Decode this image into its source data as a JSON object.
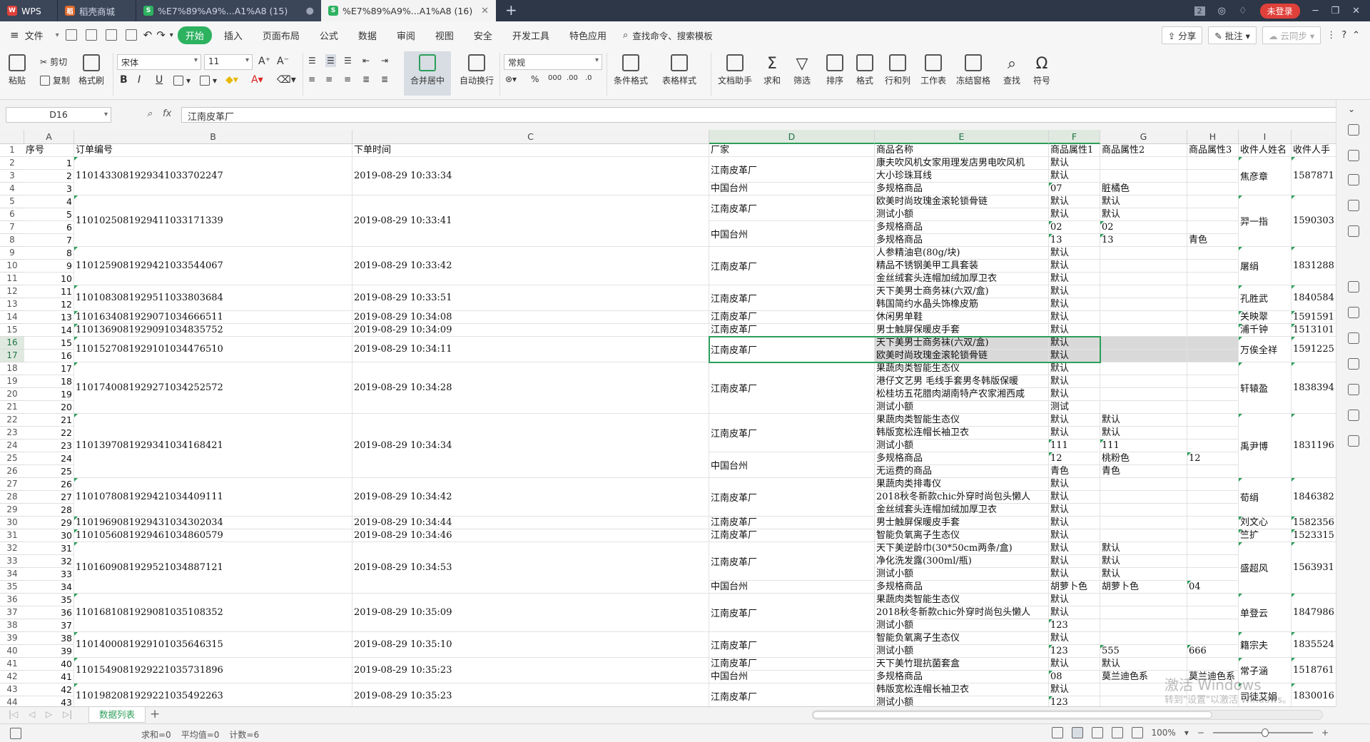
{
  "titlebar": {
    "tabs": [
      {
        "label": "WPS"
      },
      {
        "label": "稻壳商城"
      },
      {
        "label": "%E7%89%A9%...A1%A8 (15)"
      },
      {
        "label": "%E7%89%A9%...A1%A8 (16)"
      }
    ],
    "login": "未登录",
    "badge": "2"
  },
  "menubar": {
    "file": "文件",
    "items": [
      "开始",
      "插入",
      "页面布局",
      "公式",
      "数据",
      "审阅",
      "视图",
      "安全",
      "开发工具",
      "特色应用"
    ],
    "search": "查找命令、搜索模板",
    "share": "分享",
    "comment": "批注",
    "sync": "云同步"
  },
  "ribbon": {
    "paste": "粘贴",
    "cut": "剪切",
    "copy": "复制",
    "format_painter": "格式刷",
    "font": "宋体",
    "size": "11",
    "merge": "合并居中",
    "wrap": "自动换行",
    "numfmt": "常规",
    "cond_fmt": "条件格式",
    "table_style": "表格样式",
    "doc_helper": "文档助手",
    "sum": "求和",
    "filter": "筛选",
    "sort": "排序",
    "format": "格式",
    "rowcol": "行和列",
    "sheet": "工作表",
    "freeze": "冻结窗格",
    "find": "查找",
    "symbol": "符号"
  },
  "formulabar": {
    "namebox": "D16",
    "fx": "fx",
    "formula": "江南皮革厂"
  },
  "columns": [
    {
      "letter": "A"
    },
    {
      "letter": "B"
    },
    {
      "letter": "C"
    },
    {
      "letter": "D"
    },
    {
      "letter": "E"
    },
    {
      "letter": "F"
    },
    {
      "letter": "G"
    },
    {
      "letter": "H"
    },
    {
      "letter": "I"
    },
    {
      "letter": ""
    }
  ],
  "headers": [
    "序号",
    "订单编号",
    "下单时间",
    "厂家",
    "商品名称",
    "商品属性1",
    "商品属性2",
    "商品属性3",
    "收件人姓名",
    "收件人手"
  ],
  "rownums": [
    "1",
    "2",
    "3",
    "4",
    "5",
    "6",
    "7",
    "8",
    "9",
    "10",
    "11",
    "12",
    "13",
    "14",
    "15",
    "16",
    "17",
    "18",
    "19",
    "20",
    "21",
    "22",
    "23",
    "24",
    "25",
    "26",
    "27",
    "28",
    "29",
    "30",
    "31",
    "32",
    "33",
    "34",
    "35",
    "36",
    "37",
    "38",
    "39",
    "40",
    "41",
    "42",
    "43",
    "44"
  ],
  "seq": [
    "1",
    "2",
    "3",
    "4",
    "5",
    "6",
    "7",
    "8",
    "9",
    "10",
    "11",
    "12",
    "13",
    "14",
    "15",
    "16",
    "17",
    "18",
    "19",
    "20",
    "21",
    "22",
    "23",
    "24",
    "25",
    "26",
    "27",
    "28",
    "29",
    "30",
    "31",
    "32",
    "33",
    "34",
    "35",
    "36",
    "37",
    "38",
    "39",
    "40",
    "41",
    "42",
    "43"
  ],
  "orders": [
    {
      "rows": [
        2,
        3,
        4
      ],
      "id": "110143308192934103370​2247",
      "time": "2019-08-29 10:33:34",
      "recv": "焦彦章",
      "phone": "1587871"
    },
    {
      "rows": [
        5,
        6,
        7,
        8
      ],
      "id": "110102508192941103317​1339",
      "time": "2019-08-29 10:33:41",
      "recv": "羿一指",
      "phone": "1590303"
    },
    {
      "rows": [
        9,
        10,
        11
      ],
      "id": "110125908192942103354​4067",
      "time": "2019-08-29 10:33:42",
      "recv": "屠绢",
      "phone": "1831288"
    },
    {
      "rows": [
        12,
        13
      ],
      "id": "110108308192951103380​3684",
      "time": "2019-08-29 10:33:51",
      "recv": "孔胜武",
      "phone": "1840584"
    },
    {
      "rows": [
        14
      ],
      "id": "1101634081929071034666511",
      "time": "2019-08-29 10:34:08",
      "recv": "关映翠",
      "phone": "1591591"
    },
    {
      "rows": [
        15
      ],
      "id": "1101369081929091034835752",
      "time": "2019-08-29 10:34:09",
      "recv": "浦千钟",
      "phone": "1513101"
    },
    {
      "rows": [
        16,
        17
      ],
      "id": "1101527081929101034476510",
      "time": "2019-08-29 10:34:11",
      "recv": "万俟全祥",
      "phone": "1591225"
    },
    {
      "rows": [
        18,
        19,
        20,
        21
      ],
      "id": "1101740081929271034252572",
      "time": "2019-08-29 10:34:28",
      "recv": "轩辕盈",
      "phone": "1838394"
    },
    {
      "rows": [
        22,
        23,
        24,
        25,
        26
      ],
      "id": "1101397081929341034168421",
      "time": "2019-08-29 10:34:34",
      "recv": "禹尹博",
      "phone": "1831196"
    },
    {
      "rows": [
        27,
        28,
        29
      ],
      "id": "1101078081929421034409111",
      "time": "2019-08-29 10:34:42",
      "recv": "荀绢",
      "phone": "1846382"
    },
    {
      "rows": [
        30
      ],
      "id": "1101969081929431034302034",
      "time": "2019-08-29 10:34:44",
      "recv": "刘文心",
      "phone": "1582356"
    },
    {
      "rows": [
        31
      ],
      "id": "1101056081929461034860579",
      "time": "2019-08-29 10:34:46",
      "recv": "竺扩",
      "phone": "1523315"
    },
    {
      "rows": [
        32,
        33,
        34,
        35
      ],
      "id": "1101609081929521034887121",
      "time": "2019-08-29 10:34:53",
      "recv": "盛超风",
      "phone": "1563931"
    },
    {
      "rows": [
        36,
        37,
        38
      ],
      "id": "1101681081929081035108352",
      "time": "2019-08-29 10:35:09",
      "recv": "单登云",
      "phone": "1847986"
    },
    {
      "rows": [
        39,
        40
      ],
      "id": "1101400081929101035646315",
      "time": "2019-08-29 10:35:10",
      "recv": "籍宗夫",
      "phone": "1835524"
    },
    {
      "rows": [
        41,
        42
      ],
      "id": "1101549081929221035731896",
      "time": "2019-08-29 10:35:23",
      "recv": "常子涵",
      "phone": "1518761"
    },
    {
      "rows": [
        43,
        44
      ],
      "id": "1101982081929221035492263",
      "time": "2019-08-29 10:35:23",
      "recv": "司徒艾娟",
      "phone": "1830016"
    }
  ],
  "factories": [
    {
      "rows": [
        2,
        3
      ],
      "name": "江南皮革厂"
    },
    {
      "rows": [
        4
      ],
      "name": "中国台州"
    },
    {
      "rows": [
        5,
        6
      ],
      "name": "江南皮革厂"
    },
    {
      "rows": [
        7,
        8
      ],
      "name": "中国台州"
    },
    {
      "rows": [
        9,
        10,
        11
      ],
      "name": "江南皮革厂"
    },
    {
      "rows": [
        12,
        13
      ],
      "name": "江南皮革厂"
    },
    {
      "rows": [
        14
      ],
      "name": "江南皮革厂"
    },
    {
      "rows": [
        15
      ],
      "name": "江南皮革厂"
    },
    {
      "rows": [
        16,
        17
      ],
      "name": "江南皮革厂"
    },
    {
      "rows": [
        18,
        19,
        20,
        21
      ],
      "name": "江南皮革厂"
    },
    {
      "rows": [
        22,
        23,
        24
      ],
      "name": "江南皮革厂"
    },
    {
      "rows": [
        25,
        26
      ],
      "name": "中国台州"
    },
    {
      "rows": [
        27,
        28,
        29
      ],
      "name": "江南皮革厂"
    },
    {
      "rows": [
        30
      ],
      "name": "江南皮革厂"
    },
    {
      "rows": [
        31
      ],
      "name": "江南皮革厂"
    },
    {
      "rows": [
        32,
        33,
        34
      ],
      "name": "江南皮革厂"
    },
    {
      "rows": [
        35
      ],
      "name": "中国台州"
    },
    {
      "rows": [
        36,
        37,
        38
      ],
      "name": "江南皮革厂"
    },
    {
      "rows": [
        39,
        40
      ],
      "name": "江南皮革厂"
    },
    {
      "rows": [
        41
      ],
      "name": "江南皮革厂"
    },
    {
      "rows": [
        42
      ],
      "name": "中国台州"
    },
    {
      "rows": [
        43,
        44
      ],
      "name": "江南皮革厂"
    }
  ],
  "items": [
    [
      "康夫吹风机女家用理发店男电吹风机",
      "默认",
      "",
      ""
    ],
    [
      "大小珍珠耳线",
      "默认",
      "",
      ""
    ],
    [
      "多规格商品",
      "07",
      "脏橘色",
      ""
    ],
    [
      "欧美时尚玫瑰金滚轮锁骨链",
      "默认",
      "默认",
      ""
    ],
    [
      "测试小额",
      "默认",
      "默认",
      ""
    ],
    [
      "多规格商品",
      "02",
      "02",
      ""
    ],
    [
      "多规格商品",
      "13",
      "13",
      "青色"
    ],
    [
      "人参精油皂(80g/块)",
      "默认",
      "",
      ""
    ],
    [
      "精品不锈钢美甲工具套装",
      "默认",
      "",
      ""
    ],
    [
      "金丝绒套头连帽加绒加厚卫衣",
      "默认",
      "",
      ""
    ],
    [
      "天下美男士商务袜(六双/盒)",
      "默认",
      "",
      ""
    ],
    [
      "韩国简约水晶头饰橡皮筋",
      "默认",
      "",
      ""
    ],
    [
      "休闲男单鞋",
      "默认",
      "",
      ""
    ],
    [
      "男士触屏保暖皮手套",
      "默认",
      "",
      ""
    ],
    [
      "天下美男士商务袜(六双/盒)",
      "默认",
      "",
      ""
    ],
    [
      "欧美时尚玫瑰金滚轮锁骨链",
      "默认",
      "",
      ""
    ],
    [
      "果蔬肉类智能生态仪",
      "默认",
      "",
      ""
    ],
    [
      "港仔文艺男 毛线手套男冬韩版保暖",
      "默认",
      "",
      ""
    ],
    [
      "松桂坊五花腊肉湖南特产农家湘西咸",
      "默认",
      "",
      ""
    ],
    [
      "测试小额",
      "测试",
      "",
      ""
    ],
    [
      "果蔬肉类智能生态仪",
      "默认",
      "默认",
      ""
    ],
    [
      "韩版宽松连帽长袖卫衣",
      "默认",
      "默认",
      ""
    ],
    [
      "测试小额",
      "111",
      "111",
      ""
    ],
    [
      "多规格商品",
      "12",
      "桃粉色",
      "12"
    ],
    [
      "无运费的商品",
      "青色",
      "青色",
      ""
    ],
    [
      "果蔬肉类排毒仪",
      "默认",
      "",
      ""
    ],
    [
      "2018秋冬新款chic外穿时尚包头懒人",
      "默认",
      "",
      ""
    ],
    [
      "金丝绒套头连帽加绒加厚卫衣",
      "默认",
      "",
      ""
    ],
    [
      "男士触屏保暖皮手套",
      "默认",
      "",
      ""
    ],
    [
      "智能负氧离子生态仪",
      "默认",
      "",
      ""
    ],
    [
      "天下美逆龄巾(30*50cm两条/盒)",
      "默认",
      "默认",
      ""
    ],
    [
      "净化洗发露(300ml/瓶)",
      "默认",
      "默认",
      ""
    ],
    [
      "测试小额",
      "默认",
      "默认",
      ""
    ],
    [
      "多规格商品",
      "胡萝卜色",
      "胡萝卜色",
      "04"
    ],
    [
      "果蔬肉类智能生态仪",
      "默认",
      "",
      ""
    ],
    [
      "2018秋冬新款chic外穿时尚包头懒人",
      "默认",
      "",
      ""
    ],
    [
      "测试小额",
      "123",
      "",
      ""
    ],
    [
      "智能负氧离子生态仪",
      "默认",
      "",
      ""
    ],
    [
      "测试小额",
      "123",
      "555",
      "666"
    ],
    [
      "天下美竹琨抗菌套盒",
      "默认",
      "默认",
      ""
    ],
    [
      "多规格商品",
      "08",
      "莫兰迪色系",
      "莫兰迪色系"
    ],
    [
      "韩版宽松连帽长袖卫衣",
      "默认",
      "",
      ""
    ],
    [
      "测试小额",
      "123",
      "",
      ""
    ]
  ],
  "sheettab": "数据列表",
  "status": {
    "sum": "求和=0",
    "avg": "平均值=0",
    "count": "计数=6",
    "zoom": "100%"
  },
  "watermark": {
    "line1": "激活 Windows",
    "line2": "转到\"设置\"以激活 Windows。"
  }
}
